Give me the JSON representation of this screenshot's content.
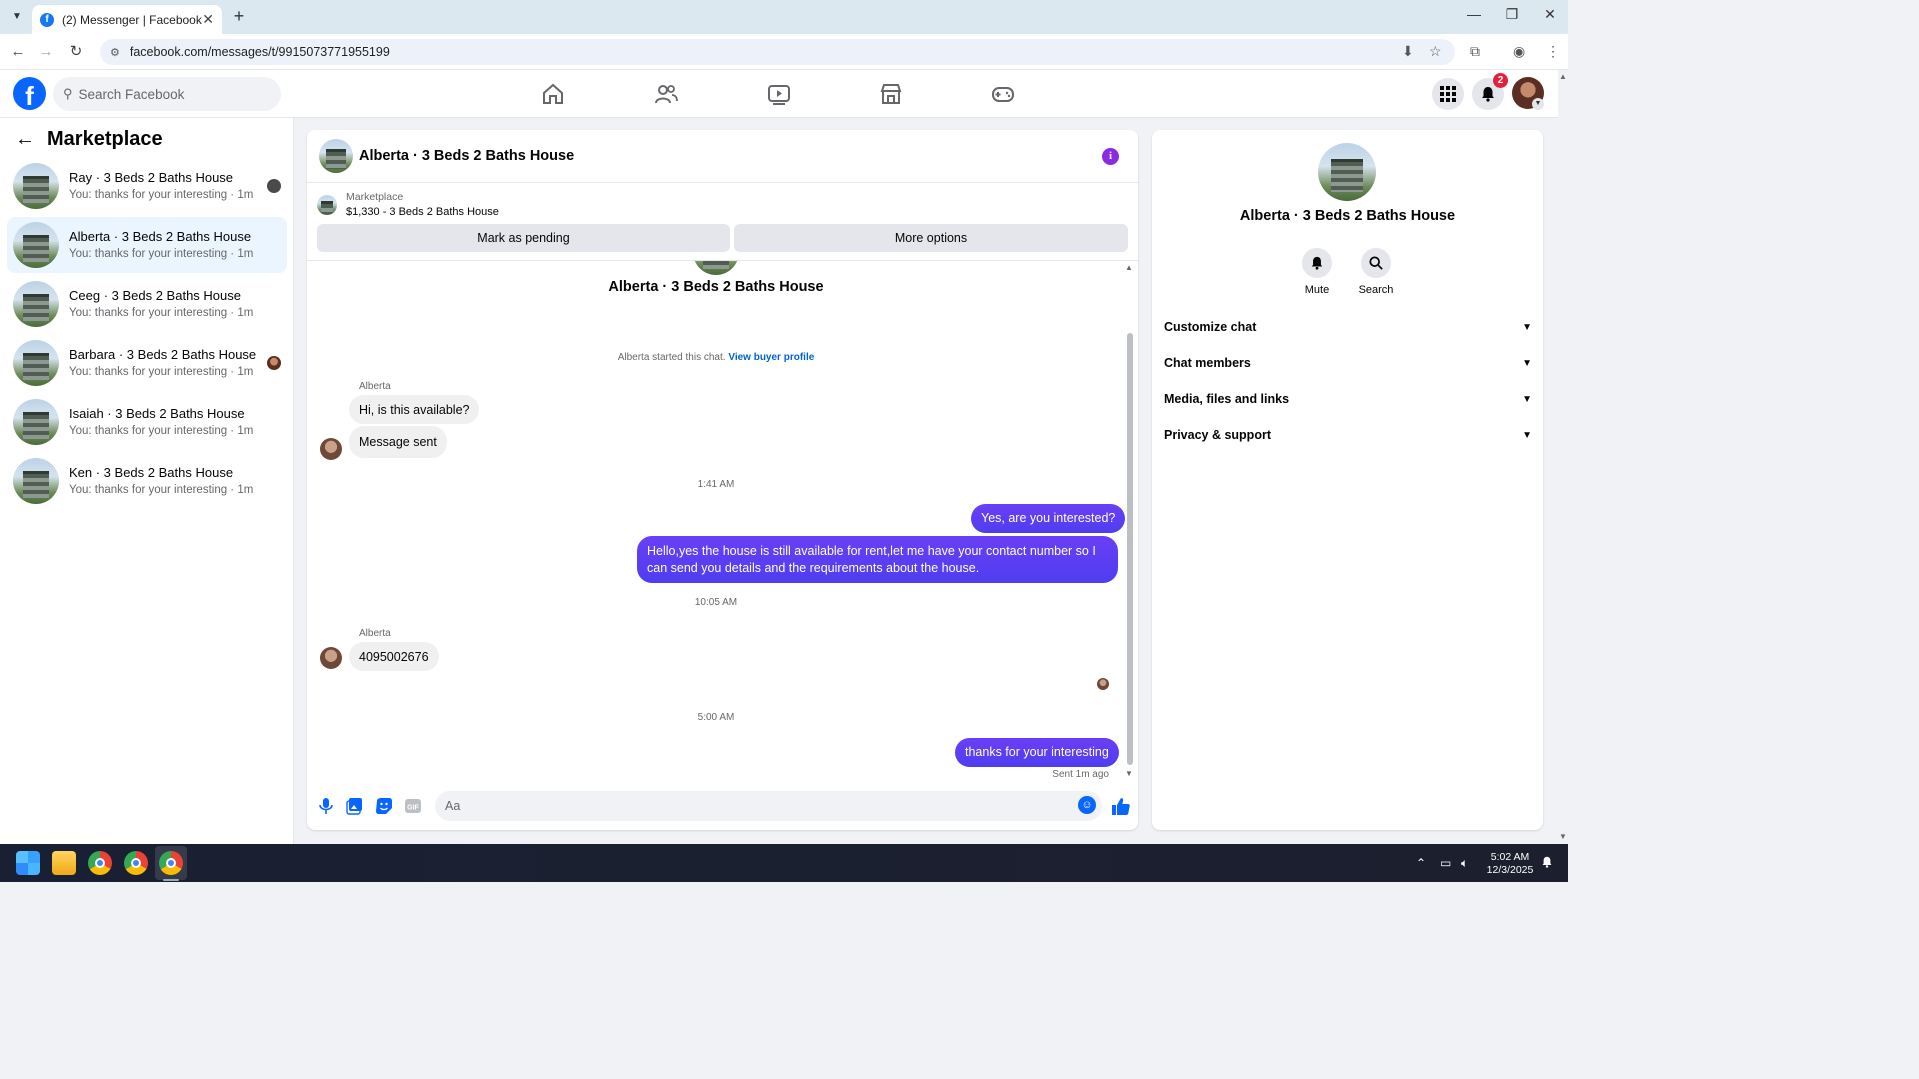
{
  "browser": {
    "tab_title": "(2) Messenger | Facebook",
    "url": "facebook.com/messages/t/9915073771955199"
  },
  "fbnav": {
    "search_placeholder": "Search Facebook",
    "notification_count": "2"
  },
  "sidebar": {
    "title": "Marketplace",
    "conversations": [
      {
        "name": "Ray · 3 Beds 2 Baths House",
        "preview": "You: thanks for your interesting · 1m"
      },
      {
        "name": "Alberta · 3 Beds 2 Baths House",
        "preview": "You: thanks for your interesting · 1m"
      },
      {
        "name": "Ceeg · 3 Beds 2 Baths House",
        "preview": "You: thanks for your interesting · 1m"
      },
      {
        "name": "Barbara · 3 Beds 2 Baths House",
        "preview": "You: thanks for your interesting · 1m"
      },
      {
        "name": "Isaiah · 3 Beds 2 Baths House",
        "preview": "You: thanks for your interesting · 1m"
      },
      {
        "name": "Ken · 3 Beds 2 Baths House",
        "preview": "You: thanks for your interesting · 1m"
      }
    ]
  },
  "chat": {
    "title": "Alberta · 3 Beds 2 Baths House",
    "listing_label": "Marketplace",
    "listing_price": "$1,330 - 3 Beds 2 Baths House",
    "mark_pending": "Mark as pending",
    "more_options": "More options",
    "intro_title": "Alberta · 3 Beds 2 Baths House",
    "started_text": "Alberta started this chat.",
    "view_buyer": "View buyer profile",
    "sender": "Alberta",
    "msg_in_1": "Hi, is this available?",
    "msg_in_2": "Message sent",
    "time_1": "1:41 AM",
    "msg_out_1": "Yes, are you interested?",
    "msg_out_2": "Hello,yes the house is still available for rent,let me have your contact number   so I can send you details and the requirements about the house.",
    "time_2": "10:05 AM",
    "msg_in_3": "4095002676",
    "time_3": "5:00 AM",
    "msg_out_3": "thanks for your interesting",
    "sent_status": "Sent 1m ago",
    "composer_placeholder": "Aa"
  },
  "details": {
    "name": "Alberta · 3 Beds 2 Baths House",
    "mute": "Mute",
    "search": "Search",
    "sections": [
      "Customize chat",
      "Chat members",
      "Media, files and links",
      "Privacy & support"
    ]
  },
  "taskbar": {
    "time": "5:02 AM",
    "date": "12/3/2025"
  },
  "colors": {
    "accent": "#0866ff",
    "outgoing_bubble": "#5b3cf6",
    "active_conversation": "#ebf5ff"
  }
}
